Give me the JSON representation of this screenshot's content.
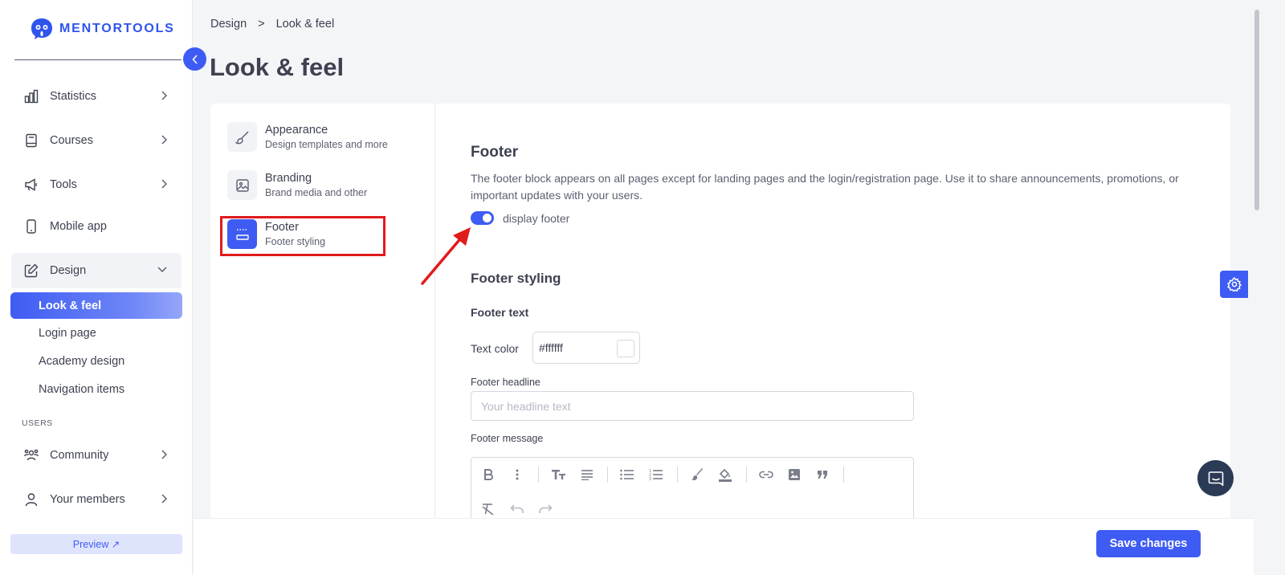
{
  "brand": {
    "name": "MENTORTOOLS",
    "color": "#2f54eb"
  },
  "sidebar": {
    "items": [
      {
        "label": "Statistics",
        "icon": "bar-chart-icon"
      },
      {
        "label": "Courses",
        "icon": "book-icon"
      },
      {
        "label": "Tools",
        "icon": "megaphone-icon"
      },
      {
        "label": "Mobile app",
        "icon": "smartphone-icon"
      },
      {
        "label": "Design",
        "icon": "pencil-square-icon"
      }
    ],
    "design_sub": [
      "Look & feel",
      "Login page",
      "Academy design",
      "Navigation items"
    ],
    "section_users": "USERS",
    "user_items": [
      {
        "label": "Community",
        "icon": "users-icon"
      },
      {
        "label": "Your members",
        "icon": "user-icon"
      }
    ],
    "preview_label": "Preview ↗"
  },
  "breadcrumb": {
    "parent": "Design",
    "separator": ">",
    "current": "Look & feel"
  },
  "page_title": "Look & feel",
  "settings_menu": [
    {
      "title": "Appearance",
      "desc": "Design templates and more",
      "icon": "brush-icon"
    },
    {
      "title": "Branding",
      "desc": "Brand media and other",
      "icon": "image-icon"
    },
    {
      "title": "Footer",
      "desc": "Footer styling",
      "icon": "footer-layout-icon"
    }
  ],
  "footer_panel": {
    "heading": "Footer",
    "description": "The footer block appears on all pages except for landing pages and the login/registration page. Use it to share announcements, promotions, or important updates with your users.",
    "toggle_label": "display footer",
    "toggle_on": true,
    "styling_heading": "Footer styling",
    "text_heading": "Footer text",
    "text_color_label": "Text color",
    "text_color_value": "#ffffff",
    "headline_label": "Footer headline",
    "headline_placeholder": "Your headline text",
    "message_label": "Footer message"
  },
  "editor_toolbar": [
    "bold-icon",
    "more-vertical-icon",
    "text-size-icon",
    "align-icon",
    "bullet-list-icon",
    "numbered-list-icon",
    "brush-color-icon",
    "fill-color-icon",
    "link-icon",
    "image-icon",
    "quote-icon",
    "clear-format-icon",
    "undo-icon",
    "redo-icon"
  ],
  "save_label": "Save changes",
  "accent_color": "#3e5cf3",
  "highlight_color": "#e01b1b"
}
